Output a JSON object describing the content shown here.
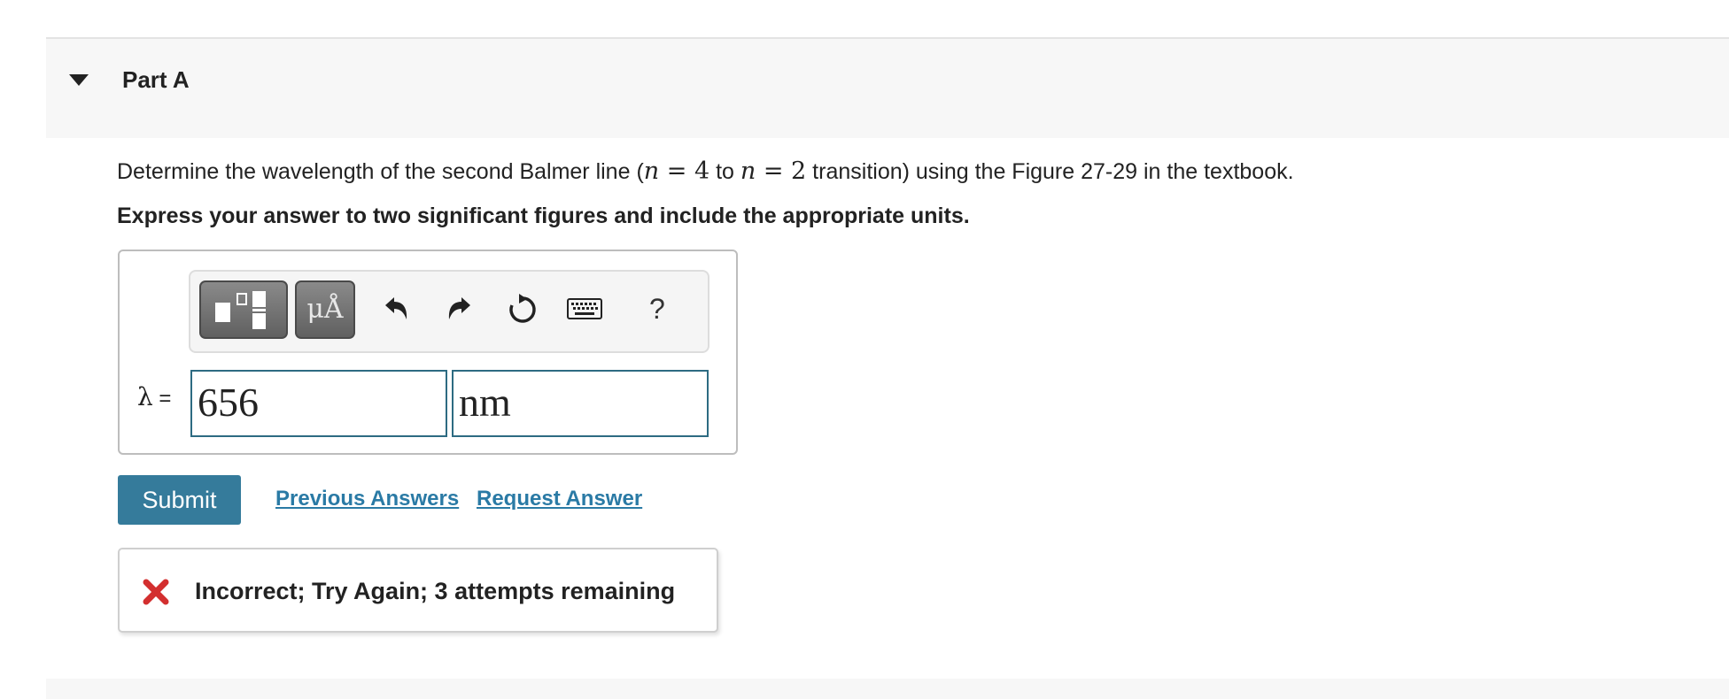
{
  "part": {
    "title": "Part A"
  },
  "question": {
    "text_before": "Determine the wavelength of the second Balmer line (",
    "n_var_1": "n",
    "eq_1": " = 4",
    "to_word": " to ",
    "n_var_2": "n",
    "eq_2": " = 2",
    "text_after": " transition) using the Figure 27-29 in the textbook."
  },
  "instruction": "Express your answer to two significant figures and include the appropriate units.",
  "toolbar": {
    "units_label": "μÅ",
    "help_label": "?"
  },
  "answer": {
    "variable": "λ",
    "equals": " =",
    "value": "656",
    "unit": "nm"
  },
  "actions": {
    "submit_label": "Submit",
    "previous_answers_label": "Previous Answers",
    "request_answer_label": "Request Answer"
  },
  "feedback": {
    "message": "Incorrect; Try Again; 3 attempts remaining",
    "status_color": "#d32f2f"
  },
  "colors": {
    "accent": "#357b9b",
    "link": "#2a7aa5",
    "field_border": "#2d6b82"
  }
}
